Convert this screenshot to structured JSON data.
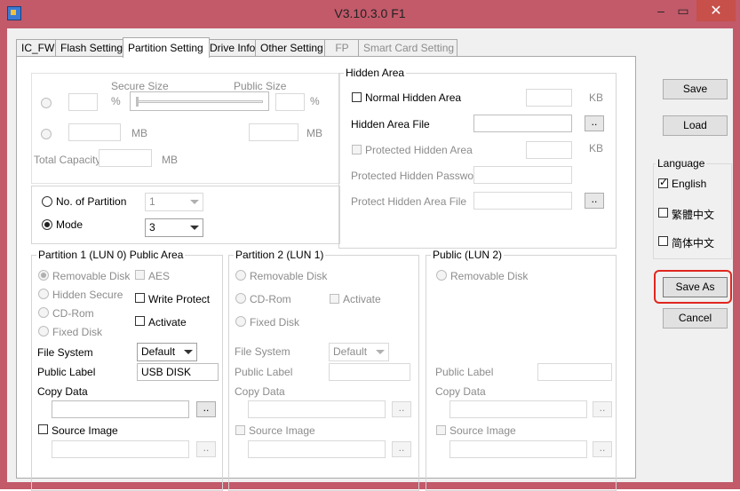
{
  "window": {
    "title": "V3.10.3.0 F1",
    "minimize": "–",
    "maximize": "▭",
    "close": "✕"
  },
  "tabs": [
    {
      "label": "IC_FW"
    },
    {
      "label": "Flash Setting"
    },
    {
      "label": "Partition Setting"
    },
    {
      "label": "Drive Info"
    },
    {
      "label": "Other Setting"
    },
    {
      "label": "FP"
    },
    {
      "label": "Smart Card Setting"
    }
  ],
  "size_group": {
    "secure_size_label": "Secure Size",
    "public_size_label": "Public Size",
    "percent_unit": "%",
    "mb_unit": "MB",
    "total_capacity_label": "Total Capacity"
  },
  "partition_mode": {
    "no_of_partition_label": "No. of Partition",
    "no_of_partition_value": "1",
    "mode_label": "Mode",
    "mode_value": "3"
  },
  "hidden_area": {
    "title": "Hidden Area",
    "normal_hidden_area": "Normal Hidden Area",
    "kb_unit": "KB",
    "hidden_area_file": "Hidden Area File",
    "protected_hidden_area": "Protected Hidden Area",
    "protected_hidden_password": "Protected Hidden Password",
    "protect_hidden_area_file": "Protect Hidden Area File",
    "browse": ".."
  },
  "partition1": {
    "title": "Partition 1 (LUN 0) Public Area",
    "removable_disk": "Removable Disk",
    "hidden_secure": "Hidden Secure",
    "cd_rom": "CD-Rom",
    "fixed_disk": "Fixed Disk",
    "aes": "AES",
    "write_protect": "Write Protect",
    "activate": "Activate",
    "file_system_label": "File System",
    "file_system_value": "Default",
    "public_label_label": "Public Label",
    "public_label_value": "USB DISK",
    "copy_data_label": "Copy Data",
    "source_image_label": "Source Image",
    "browse": ".."
  },
  "partition2": {
    "title": "Partition 2 (LUN 1)",
    "removable_disk": "Removable Disk",
    "cd_rom": "CD-Rom",
    "activate": "Activate",
    "fixed_disk": "Fixed Disk",
    "file_system_label": "File System",
    "file_system_value": "Default",
    "public_label_label": "Public Label",
    "copy_data_label": "Copy Data",
    "source_image_label": "Source Image",
    "browse": ".."
  },
  "public_lun2": {
    "title": "Public (LUN 2)",
    "removable_disk": "Removable Disk",
    "public_label_label": "Public Label",
    "copy_data_label": "Copy Data",
    "source_image_label": "Source Image",
    "browse": ".."
  },
  "right_panel": {
    "save": "Save",
    "load": "Load",
    "language_title": "Language",
    "lang_english": "English",
    "lang_trad_chinese": "繁體中文",
    "lang_simp_chinese": "简体中文",
    "save_as": "Save As",
    "cancel": "Cancel"
  },
  "colors": {
    "highlight_ring": "#e0271f",
    "title_bar": "#c25a6a",
    "close_button": "#c7504b"
  }
}
